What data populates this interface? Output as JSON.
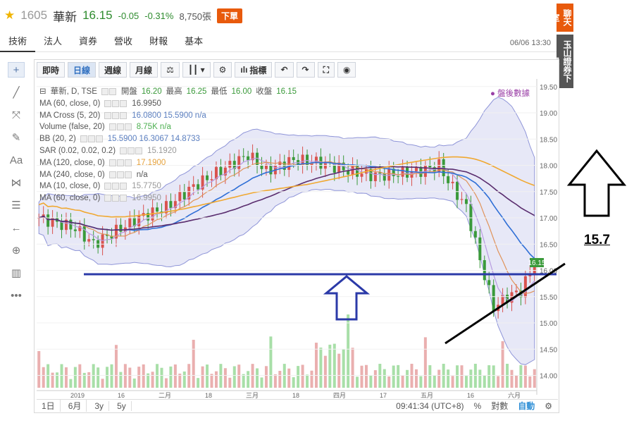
{
  "header": {
    "code": "1605",
    "name": "華新",
    "price": "16.15",
    "change": "-0.05",
    "change_pct": "-0.31%",
    "volume": "8,750張",
    "order_button": "下單",
    "datetime": "06/06 13:30"
  },
  "nav_tabs": [
    "技術",
    "法人",
    "資券",
    "營收",
    "財報",
    "基本"
  ],
  "side_buttons": [
    "聊天室",
    "玉山證券下單"
  ],
  "left_tools": [
    "crosshair-icon",
    "line-icon",
    "fork-icon",
    "brush-icon",
    "text-icon",
    "pattern-icon",
    "fib-icon",
    "back-arrow-icon",
    "zoom-icon",
    "ruler-icon",
    "more-icon"
  ],
  "left_tool_glyphs": [
    "+",
    "╱",
    "⤧",
    "✎",
    "Aa",
    "⋈",
    "☰",
    "←",
    "⊕",
    "▥",
    "•••"
  ],
  "toolbar": {
    "intraday": "即時",
    "daily": "日線",
    "weekly": "週線",
    "monthly": "月線",
    "indicators": "指標"
  },
  "legend": {
    "title": "華新, D, TSE",
    "open_label": "開盤",
    "open": "16.20",
    "high_label": "最高",
    "high": "16.25",
    "low_label": "最低",
    "low": "16.00",
    "close_label": "收盤",
    "close": "16.15",
    "lines": [
      {
        "label": "MA (60, close, 0)",
        "value": "16.9950",
        "color": "#555"
      },
      {
        "label": "MA Cross (5, 20)",
        "value": "16.0800  15.5900  n/a",
        "color": "#5b7fc0"
      },
      {
        "label": "Volume (false, 20)",
        "value": "8.75K  n/a",
        "color": "#4caf50"
      },
      {
        "label": "BB (20, 2)",
        "value": "15.5900  16.3067  14.8733",
        "color": "#5b7fc0"
      },
      {
        "label": "SAR (0.02, 0.02, 0.2)",
        "value": "15.1920",
        "color": "#999"
      },
      {
        "label": "MA (120, close, 0)",
        "value": "17.1900",
        "color": "#e6a23c"
      },
      {
        "label": "MA (240, close, 0)",
        "value": "n/a",
        "color": "#555"
      },
      {
        "label": "MA (10, close, 0)",
        "value": "15.7750",
        "color": "#999"
      },
      {
        "label": "MA (60, close, 0)",
        "value": "16.9950",
        "color": "#999"
      }
    ]
  },
  "after_hours": "● 盤後數據",
  "price_axis": {
    "ticks": [
      "19.50",
      "19.00",
      "18.50",
      "18.00",
      "17.50",
      "17.00",
      "16.50",
      "16.00",
      "15.50",
      "15.00",
      "14.50",
      "14.00"
    ],
    "current_label": "16.15"
  },
  "time_axis": [
    "2019",
    "16",
    "二月",
    "18",
    "三月",
    "18",
    "四月",
    "17",
    "五月",
    "16",
    "六月"
  ],
  "bottom_bar": {
    "ranges": [
      "1日",
      "6月",
      "3y",
      "5y"
    ],
    "clock": "09:41:34 (UTC+8)",
    "percent": "%",
    "log": "對數",
    "auto": "自動"
  },
  "annotation_price": "15.7",
  "chart_data": {
    "type": "candlestick",
    "support_level": 15.9,
    "current_price": 16.15,
    "ma_60_last": 16.995,
    "ma_120_last": 17.19,
    "bb_last": {
      "mid": 15.59,
      "upper": 16.3067,
      "lower": 14.8733
    },
    "ylim": [
      13.9,
      19.55
    ]
  },
  "colors": {
    "up": "#d9534f",
    "down": "#3a9a3a",
    "support_line": "#2b3aa8",
    "price_tag": "#3a9a3a"
  }
}
